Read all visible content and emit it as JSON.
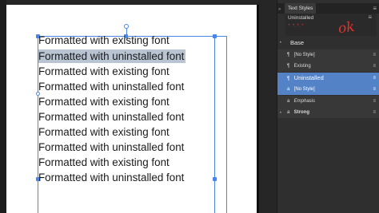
{
  "canvas": {
    "lines": [
      "Formatted with existing font",
      "Formatted with uninstalled font",
      "Formatted with existing font",
      "Formatted with uninstalled font",
      "Formatted with existing font",
      "Formatted with uninstalled font",
      "Formatted with existing font",
      "Formatted with uninstalled font",
      "Formatted with existing font",
      "Formatted with uninstalled font"
    ],
    "selected_line_index": 1
  },
  "panel": {
    "collapse_glyph": "»",
    "tab_label": "Text Styles",
    "menu_glyph": "≡",
    "preview": {
      "style_name": "Uninstalled",
      "sample_text": "ꜛ·ꜛ·ꜛ·ꜛ",
      "annotation": "ok",
      "menu_glyph": "≡"
    },
    "rows": [
      {
        "label": "Base",
        "icon": "",
        "menu": ""
      },
      {
        "label": "[No Style]",
        "icon": "¶",
        "menu": "≡"
      },
      {
        "label": "Existing",
        "icon": "¶",
        "menu": "≡"
      },
      {
        "label": "Uninstalled",
        "icon": "¶",
        "menu": "≡"
      },
      {
        "label": "[No Style]",
        "icon": "a",
        "menu": "≡"
      },
      {
        "label": "Emphasis",
        "icon": "a",
        "menu": "≡"
      },
      {
        "label": "Strong",
        "icon": "a",
        "menu": "≡"
      }
    ],
    "base_arrow": "▸",
    "strong_arrow": "▸"
  },
  "colors": {
    "selection_blue": "#5482c6",
    "frame_blue": "#4a86e8",
    "annotation_red": "#e0322b"
  }
}
